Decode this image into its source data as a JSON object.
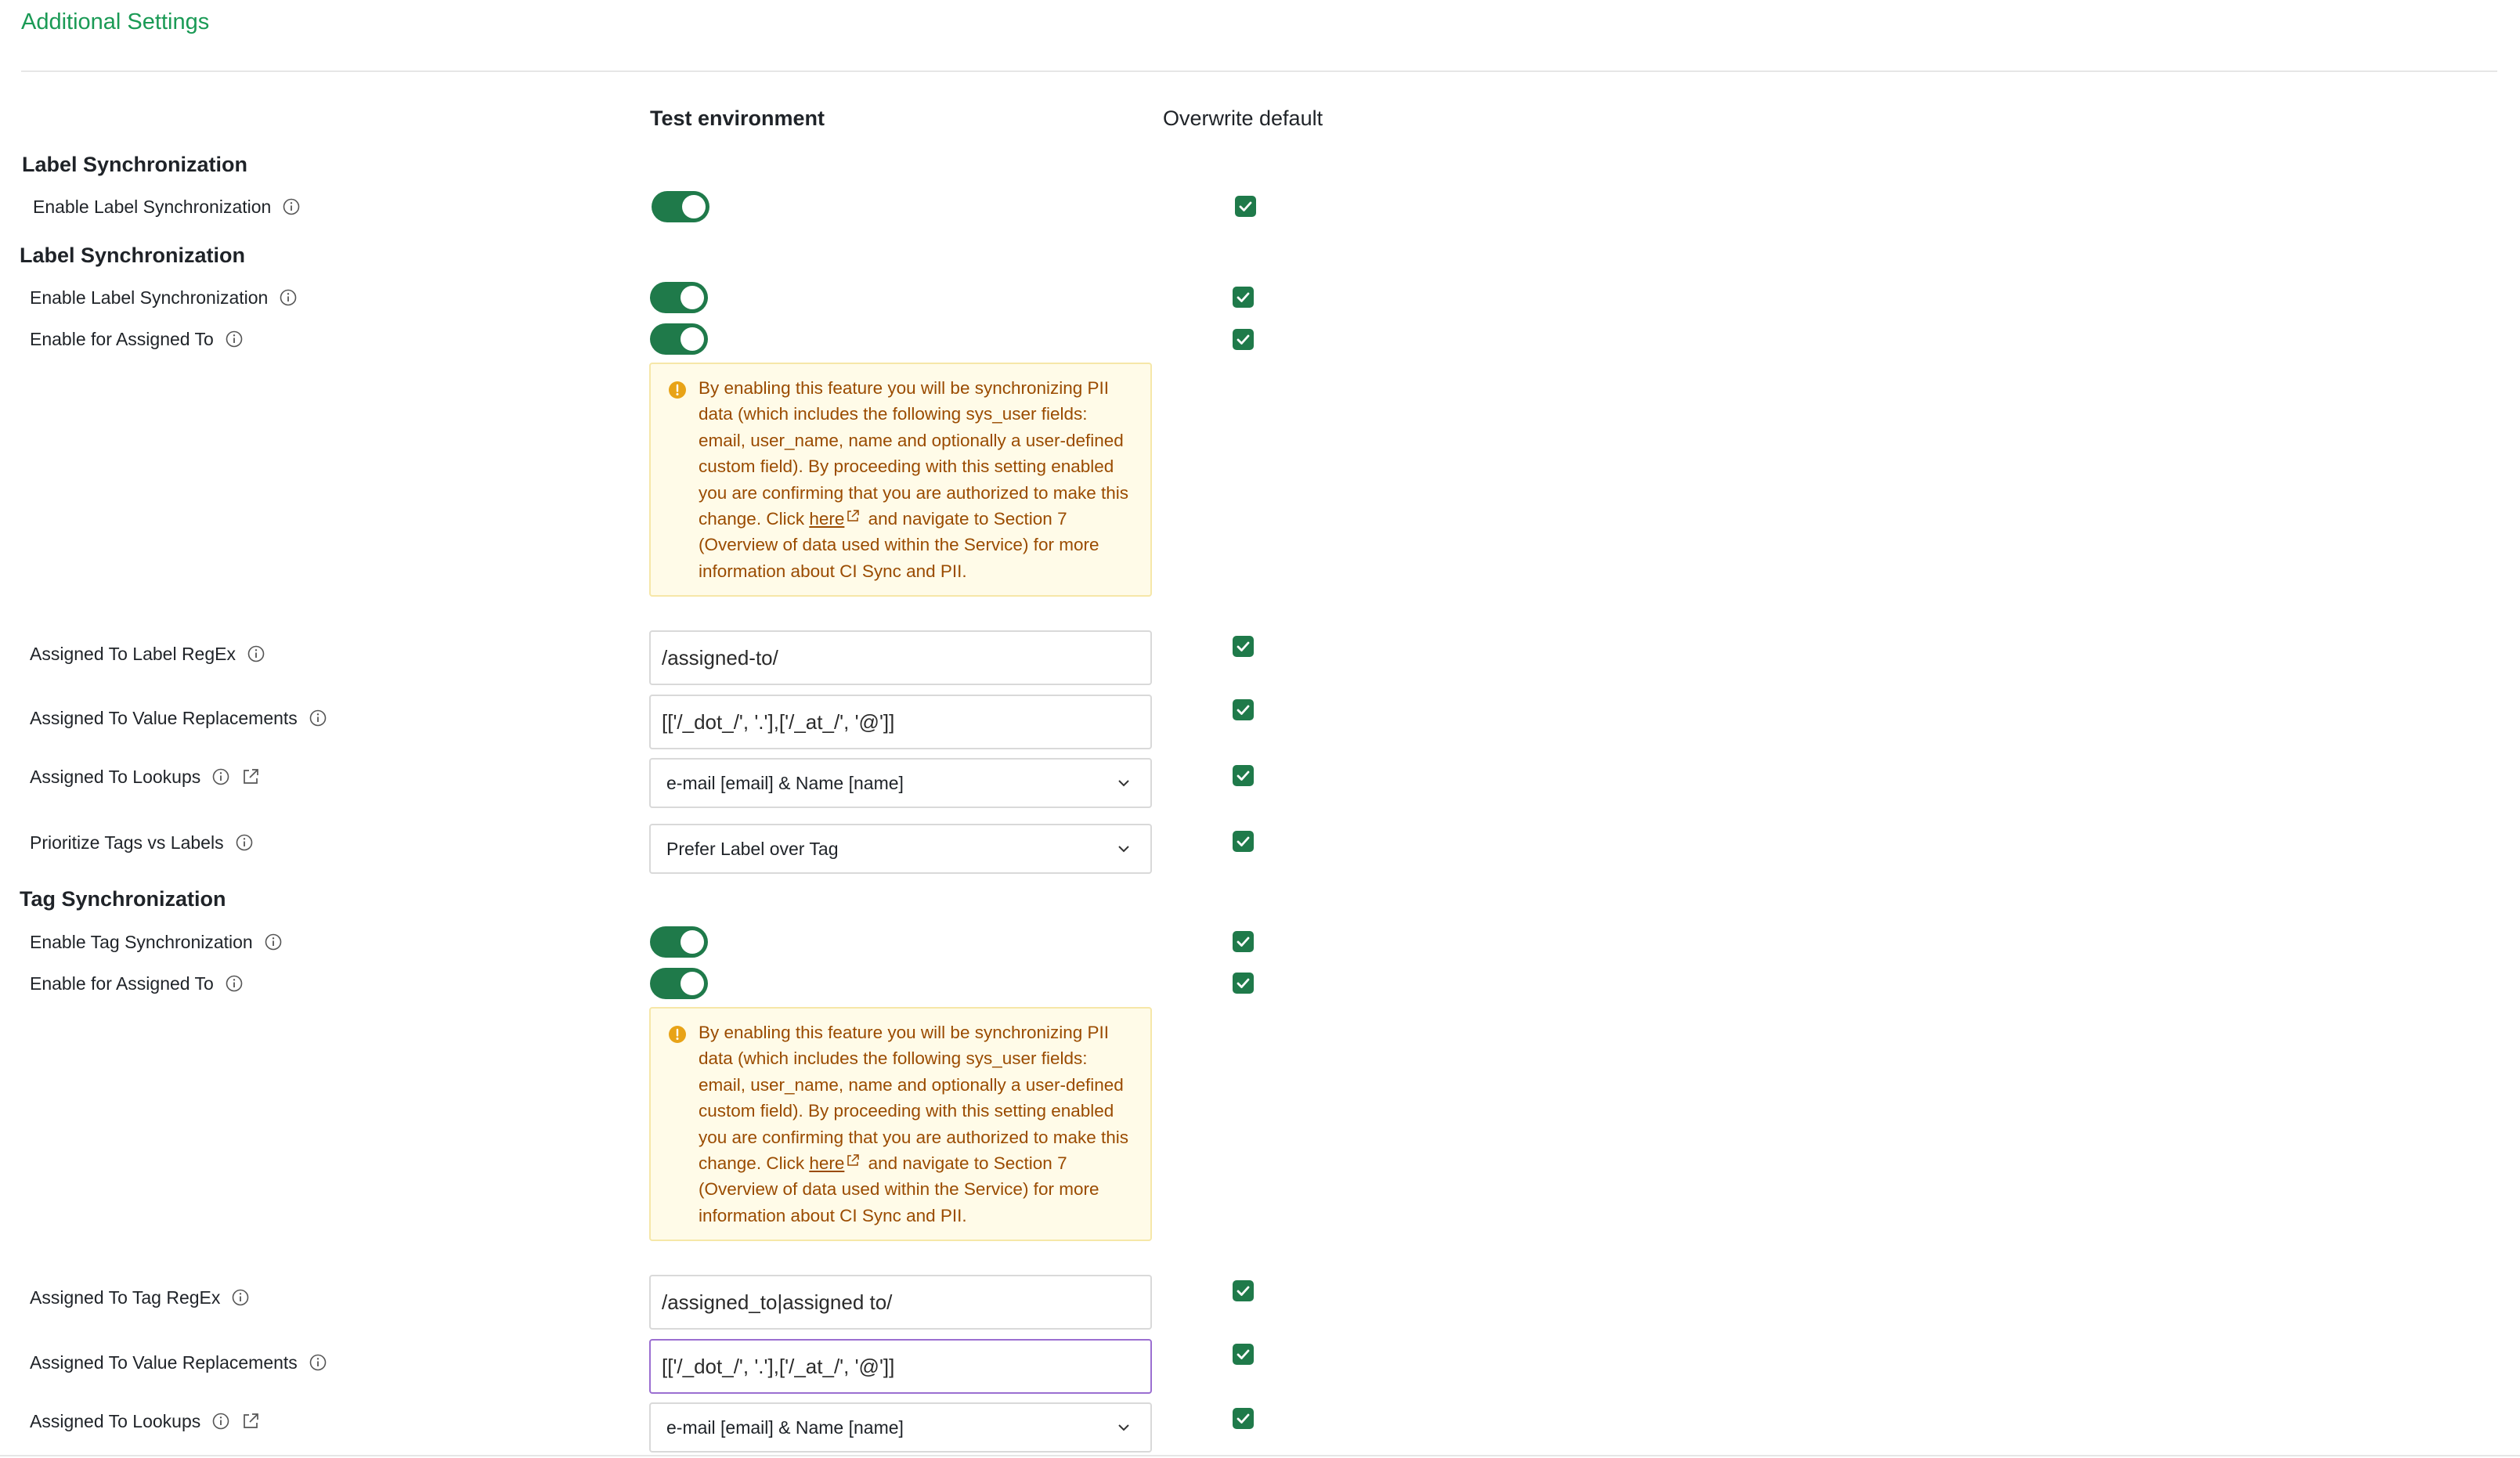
{
  "page": {
    "title": "Additional Settings"
  },
  "columns": {
    "test_environment": "Test environment",
    "overwrite_default": "Overwrite default"
  },
  "sections": [
    {
      "title": "Label Synchronization",
      "rows": [
        {
          "label": "Enable Label Synchronization",
          "toggle_on": true,
          "overwrite": true
        }
      ]
    },
    {
      "title": "Label Synchronization",
      "rows": [
        {
          "label": "Enable Label Synchronization",
          "toggle_on": true,
          "overwrite": true
        },
        {
          "label": "Enable for Assigned To",
          "toggle_on": true,
          "overwrite": true
        },
        {
          "label": "Assigned To Label RegEx",
          "value": "/assigned-to/",
          "overwrite": true
        },
        {
          "label": "Assigned To Value Replacements",
          "value": "[['/_dot_/', '.'],['/_at_/', '@']]",
          "overwrite": true
        },
        {
          "label": "Assigned To Lookups",
          "selected": "e-mail [email] & Name [name]",
          "overwrite": true
        },
        {
          "label": "Prioritize Tags vs Labels",
          "selected": "Prefer Label over Tag",
          "overwrite": true
        }
      ]
    },
    {
      "title": "Tag Synchronization",
      "rows": [
        {
          "label": "Enable Tag Synchronization",
          "toggle_on": true,
          "overwrite": true
        },
        {
          "label": "Enable for Assigned To",
          "toggle_on": true,
          "overwrite": true
        },
        {
          "label": "Assigned To Tag RegEx",
          "value": "/assigned_to|assigned to/",
          "overwrite": true
        },
        {
          "label": "Assigned To Value Replacements",
          "value": "[['/_dot_/', '.'],['/_at_/', '@']]",
          "overwrite": true
        },
        {
          "label": "Assigned To Lookups",
          "selected": "e-mail [email] & Name [name]",
          "overwrite": true
        }
      ]
    }
  ],
  "warning": {
    "before_link": "By enabling this feature you will be synchronizing PII data (which includes the following sys_user fields: email, user_name, name and optionally a user-defined custom field). By proceeding with this setting enabled you are confirming that you are authorized to make this change. Click ",
    "link_text": "here",
    "after_link": "and navigate to Section 7 (Overview of data used within the Service) for more information about CI Sync and PII."
  },
  "colors": {
    "accent": "#1f7a4a",
    "title": "#1a9a55",
    "warning_bg": "#fffbe8",
    "warning_text": "#9a4b00"
  }
}
